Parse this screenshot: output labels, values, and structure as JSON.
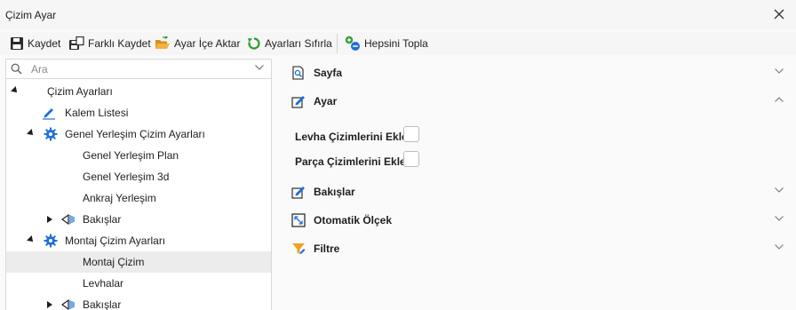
{
  "window": {
    "title": "Çizim Ayar"
  },
  "toolbar": {
    "save": "Kaydet",
    "save_as": "Farklı Kaydet",
    "import": "Ayar İçe Aktar",
    "reset": "Ayarları Sıfırla",
    "collapse_all": "Hepsini Topla"
  },
  "search": {
    "placeholder": "Ara",
    "value": ""
  },
  "tree": {
    "root": "Çizim Ayarları",
    "pen_list": "Kalem Listesi",
    "general": "Genel Yerleşim Çizim Ayarları",
    "general_plan": "Genel Yerleşim Plan",
    "general_3d": "Genel Yerleşim 3d",
    "anchor": "Ankraj Yerleşim",
    "views1": "Bakışlar",
    "assembly": "Montaj Çizim Ayarları",
    "assembly_drawing": "Montaj Çizim",
    "plates": "Levhalar",
    "views2": "Bakışlar"
  },
  "sections": {
    "page": "Sayfa",
    "setting": "Ayar",
    "views": "Bakışlar",
    "auto_scale": "Otomatik Ölçek",
    "filter": "Filtre"
  },
  "fields": {
    "add_plate_drawings": {
      "label": "Levha Çizimlerini Ekle",
      "checked": false
    },
    "add_part_drawings": {
      "label": "Parça Çizimlerini Ekle",
      "checked": false
    }
  },
  "colors": {
    "gear": "#1e6fd9",
    "pen": "#1e6fd9",
    "filter": "#f0a020",
    "reset": "#2e9c2e",
    "collapse": "#1e6fd9"
  }
}
